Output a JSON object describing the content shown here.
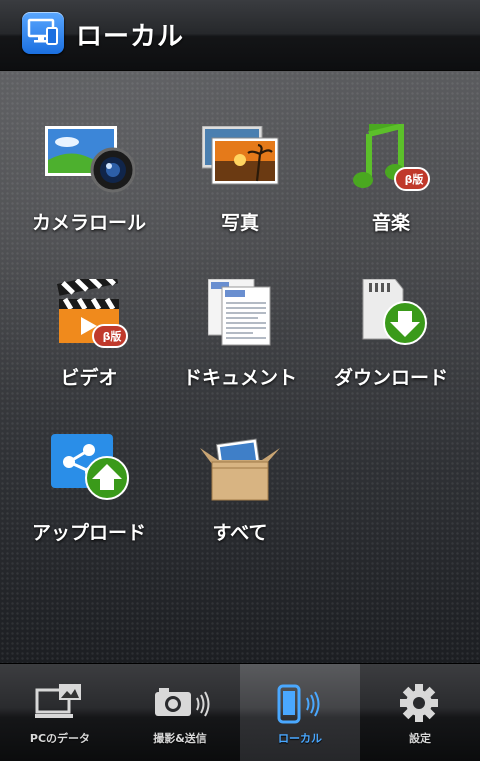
{
  "header": {
    "title": "ローカル",
    "app_icon": "monitor-phone-icon"
  },
  "menu": [
    {
      "label": "カメラロール",
      "icon": "camera-roll-icon"
    },
    {
      "label": "写真",
      "icon": "photos-icon"
    },
    {
      "label": "音楽",
      "icon": "music-note-icon",
      "badge": "β版"
    },
    {
      "label": "ビデオ",
      "icon": "video-clapper-icon",
      "badge": "β版"
    },
    {
      "label": "ドキュメント",
      "icon": "document-icon"
    },
    {
      "label": "ダウンロード",
      "icon": "download-icon"
    },
    {
      "label": "アップロード",
      "icon": "upload-share-icon"
    },
    {
      "label": "すべて",
      "icon": "box-icon"
    }
  ],
  "tabs": [
    {
      "label": "PCのデータ",
      "icon": "pc-data-icon",
      "active": false
    },
    {
      "label": "撮影&送信",
      "icon": "camera-send-icon",
      "active": false
    },
    {
      "label": "ローカル",
      "icon": "phone-local-icon",
      "active": true
    },
    {
      "label": "設定",
      "icon": "gear-icon",
      "active": false
    }
  ],
  "colors": {
    "active_tab": "#4aa8ff",
    "badge": "#c0392b",
    "download_green": "#3a9a1a"
  }
}
